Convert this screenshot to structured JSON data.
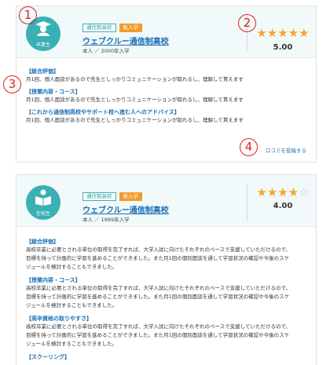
{
  "markers": [
    "1",
    "2",
    "3",
    "4"
  ],
  "reviews": [
    {
      "avatar_label": "卒業生",
      "tags": [
        "通信制高校",
        "転入学"
      ],
      "school_name": "ウェブクルー通信制高校",
      "meta": "本人 ／ 2000年入学",
      "stars": [
        "★",
        "★",
        "★",
        "★",
        "★"
      ],
      "rating": "5.00",
      "sections": [
        {
          "title": "【総合評価】",
          "text": "月1回、個人面談があるので先生としっかりコミュニケーションが取れるし、理解して貰えます"
        },
        {
          "title": "【授業内容・コース】",
          "text": "月1回、個人面談があるので先生としっかりコミュニケーションが取れるし、理解して貰えます"
        },
        {
          "title": "【これから通信制高校やサポート校へ進む人へのアドバイス】",
          "text": "月1回、個人面談があるので先生としっかりコミュニケーションが取れるし、理解して貰えます"
        }
      ],
      "post_link": "口コミを投稿する"
    },
    {
      "avatar_label": "在校生",
      "tags": [
        "通信制高校",
        "新入学"
      ],
      "school_name": "ウェブクルー通信制高校",
      "meta": "本人 ／ 1999年入学",
      "stars": [
        "★",
        "★",
        "★",
        "★",
        "☆"
      ],
      "rating": "4.00",
      "sections": [
        {
          "title": "【総合評価】",
          "lines": [
            "高校卒業に必要とされる単位の取得を完了すれば、大学入試に向けたそれぞれのペースで支援していただけるので、",
            "目標を持って計画的に学習を進めることができました。また月1回の個別面談を通して学習状況の確認や今後のスケ",
            "ジュールを検討することもできました。"
          ]
        },
        {
          "title": "【授業内容・コース】",
          "lines": [
            "高校卒業に必要とされる単位の取得を完了すれば、大学入試に向けたそれぞれのペースで支援していただけるので、",
            "目標を持って計画的に学習を進めることができました。また月1回の個別面談を通して学習状況の確認や今後のスケ",
            "ジュールを検討することもできました。"
          ]
        },
        {
          "title": "【高卒資格の取りやすさ】",
          "lines": [
            "高校卒業に必要とされる単位の取得を完了すれば、大学入試に向けたそれぞれのペースで支援していただけるので、",
            "目標を持って計画的に学習を進めることができました。また月1回の個別面談を通して学習状況の確認や今後のスケ",
            "ジュールを検討することもできました。"
          ]
        },
        {
          "title": "【スクーリング】"
        }
      ]
    }
  ],
  "colors": {
    "accent": "#3ab0b5",
    "link": "#1a6fb7",
    "star": "#f5a623",
    "marker": "#e11f1f",
    "tag_orange": "#f39a2b"
  }
}
